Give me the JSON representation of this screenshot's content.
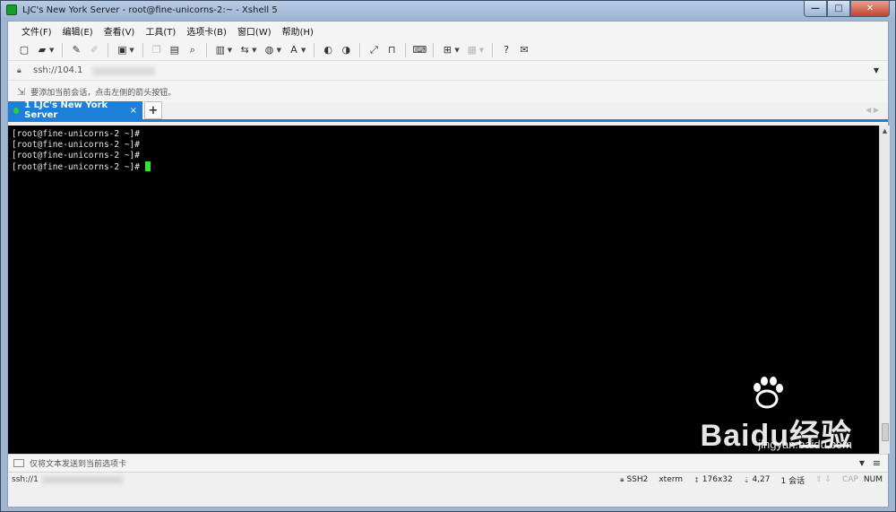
{
  "window": {
    "title": "LJC's New York Server - root@fine-unicorns-2:~ - Xshell 5",
    "controls": {
      "minimize": "—",
      "maximize": "□",
      "close": "✕"
    }
  },
  "menu": {
    "items": [
      "文件(F)",
      "编辑(E)",
      "查看(V)",
      "工具(T)",
      "选项卡(B)",
      "窗口(W)",
      "帮助(H)"
    ]
  },
  "toolbar": {
    "icons": [
      "new-session-icon",
      "open-folder-icon",
      "pencil-icon",
      "eraser-icon",
      "properties-icon",
      "copy-icon",
      "paste-icon",
      "find-icon",
      "print-icon",
      "transfer-icon",
      "globe-icon",
      "font-icon",
      "xftp-icon",
      "script-icon",
      "fullscreen-icon",
      "lock-icon",
      "keyboard-icon",
      "add-tab-icon",
      "layout-icon",
      "help-icon",
      "chat-icon"
    ]
  },
  "address": {
    "value": "ssh://104.1"
  },
  "hint": {
    "text": "要添加当前会话，点击左侧的箭头按钮。"
  },
  "tabs": [
    {
      "label": "1 LJC's New York Server",
      "close": "×",
      "active": true
    }
  ],
  "tab_add": "+",
  "terminal": {
    "lines": [
      "[root@fine-unicorns-2 ~]#",
      "[root@fine-unicorns-2 ~]#",
      "[root@fine-unicorns-2 ~]#",
      "[root@fine-unicorns-2 ~]#"
    ],
    "cursor_color": "#2ee82e"
  },
  "watermark": {
    "main": "Baidu经验",
    "sub": "jingyan.baidu.com"
  },
  "compose": {
    "placeholder": "仅将文本发送到当前选项卡"
  },
  "status": {
    "left": "ssh://1",
    "protocol": "SSH2",
    "terminal_type": "xterm",
    "size": "176x32",
    "position": "4,27",
    "sessions": "1 会话",
    "cap": "CAP",
    "num": "NUM"
  },
  "colors": {
    "tab_active": "#1d7fd8",
    "terminal_bg": "#000000",
    "connected_dot": "#2ecc40"
  }
}
